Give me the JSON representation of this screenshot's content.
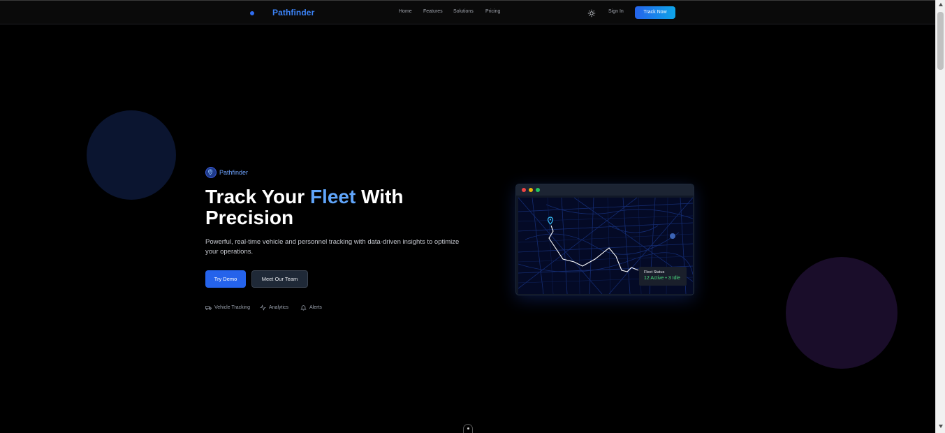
{
  "header": {
    "logo_text": "Pathfinder",
    "nav": [
      "Home",
      "Features",
      "Solutions",
      "Pricing"
    ],
    "signin_label": "Sign In",
    "cta_label": "Track Now"
  },
  "hero": {
    "badge": "Pathfinder",
    "title_part1": "Track Your ",
    "title_accent": "Fleet",
    "title_part2": " With",
    "title_line2": "Precision",
    "subtitle": "Powerful, real-time vehicle and personnel tracking with data-driven insights to optimize your operations.",
    "primary_button": "Try Demo",
    "secondary_button": "Meet Our Team",
    "features": [
      "Vehicle Tracking",
      "Analytics",
      "Alerts"
    ]
  },
  "map_card": {
    "status_title": "Fleet Status",
    "status_value": "12 Active • 3 Idle"
  },
  "colors": {
    "accent": "#3b82f6",
    "primary_button": "#2563eb",
    "status_green": "#4ade80"
  }
}
